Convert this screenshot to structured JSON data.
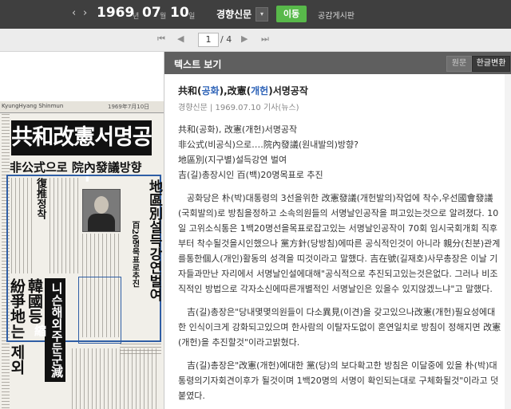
{
  "toolbar": {
    "prev_arrow": "‹",
    "next_arrow": "›",
    "year": "1969",
    "year_unit": "년",
    "month": "07",
    "month_unit": "월",
    "day": "10",
    "day_unit": "일",
    "newspaper": "경향신문",
    "dropdown_glyph": "▾",
    "go_label": "이동",
    "board_link": "공감게시판"
  },
  "pager": {
    "first": "⏮",
    "prev": "◀",
    "current": "1",
    "total": "/ 4",
    "next": "▶",
    "last": "⏭"
  },
  "scan": {
    "masthead": "KyungHyang Shinmun",
    "mast_date": "1969年7月10日",
    "headline": "共和改憲서명공작",
    "subhead": "非公式으로 院內發議방향",
    "vert_main": "地區別설득강연벌여",
    "vert_sub1": "百20명목표로추진",
    "vert_sub2": "復推정착",
    "band_text": "니슨해외주둔군減縮",
    "big_left1": "韓國등",
    "big_left2": "紛爭地는 제외"
  },
  "textview": {
    "title": "텍스트 보기",
    "tab_original": "원문",
    "tab_hanja": "한글변환"
  },
  "article": {
    "title_parts": [
      "共和(",
      "공화",
      "),改憲(",
      "개헌",
      ")서명공작"
    ],
    "meta": "경향신문 | 1969.07.10 기사(뉴스)",
    "lines": [
      "共和(공화), 改憲(개헌)서명공작",
      "非公式(비공식)으로‥‥院內發議(원내발의)방향?",
      "地區別(지구별)설득강연 벌여",
      "吉(길)총장시인 百(백)20명목표로 추진"
    ],
    "para1": "공화당은 朴(박)대통령의 3선을위한 改憲發議(개헌발의)작업에 착수,우선國會發議(국회발의)로 방침을정하고 소속의원들의 서명날인공작을 펴고있는것으로 알려졌다. 10일 고위소식통은 1백20명선을목표로잡고있는 서명날인공작이 70회 임시국회개회 직후부터 착수될것을시인했으나 黨方針(당방침)에따른 공식적인것이 아니라 親分(친분)관계를통한個人(개인)활동의 성격을 띠것이라고 말했다. 吉在號(길재호)사무총장은 이날 기자들과만난 자리에서 서명날인설에대해\"공식적으로 추진되고있는것은없다. 그러나 비조직적인 방법으로 각자소신에따른개별적인 서명날인은 있을수 있지않겠느냐\"고 말했다.",
    "para2": "吉(길)총장은\"당내몇몇의원들이 다소異見(이견)을 갖고있으나改憲(개헌)필요성에대한 인식이크게 강화되고있으며 한사람의 이탈자도없이 혼연일치로 방침이 정해지면 改憲(개헌)을 추진할것\"이라고밝혔다.",
    "para3": "吉(길)총장은\"改憲(개헌)에대한 黨(당)의 보다확고한 방침은 이달중에 있을 朴(박)대통령의기자회견이후가 될것이며 1백20명의 서명이 확인되는대로 구체화될것\"이라고 덧붙였다."
  }
}
